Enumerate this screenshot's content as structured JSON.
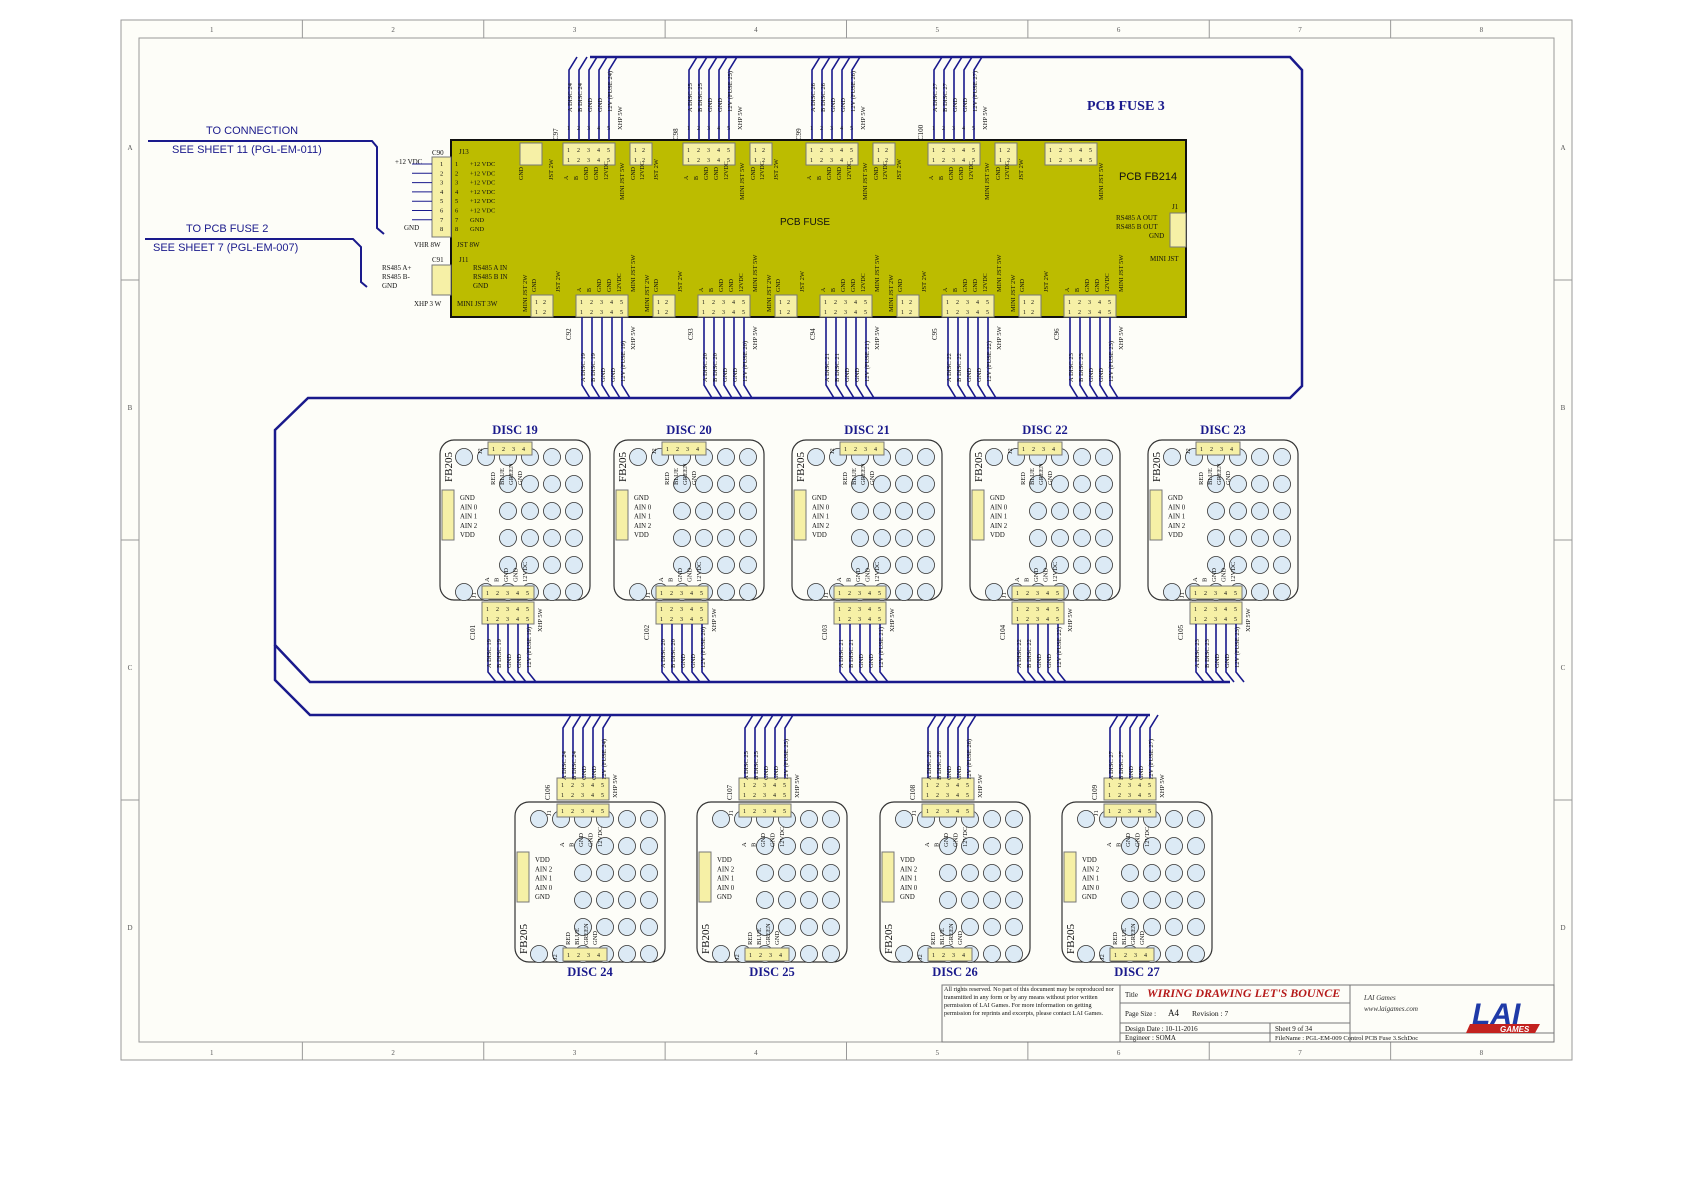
{
  "frame": {
    "columns": [
      "1",
      "2",
      "3",
      "4",
      "5",
      "6",
      "7",
      "8"
    ],
    "rows": [
      "A",
      "B",
      "C",
      "D"
    ]
  },
  "top": {
    "pcb_title": "PCB FUSE 3",
    "board_name": "PCB FB214",
    "board_center": "PCB FUSE",
    "conn1_title": "TO CONNECTION",
    "conn1_sheet": "SEE SHEET 11 (PGL-EM-011)",
    "conn2_title": "TO PCB FUSE 2",
    "conn2_sheet": "SEE SHEET 7 (PGL-EM-007)",
    "c90": "C90",
    "c91": "C91",
    "j13": "J13",
    "j11": "J11",
    "j1": "J1",
    "vdc12": "+12 VDC",
    "gnd": "GND",
    "vhr8": "VHR 8W",
    "jst8": "JST 8W",
    "rs485a": "RS485 A+",
    "rs485b": "RS485 B-",
    "rs485a_in": "RS485 A IN",
    "rs485b_in": "RS485 B IN",
    "xhp3": "XHP 3 W",
    "mini3": "MINI JST 3W",
    "rs485a_out": "RS485 A OUT",
    "rs485b_out": "RS485 B OUT",
    "mini_jst": "MINI JST",
    "pins12": [
      "+12 VDC",
      "+12 VDC",
      "+12 VDC",
      "+12 VDC",
      "+12 VDC",
      "+12 VDC",
      "GND",
      "GND"
    ],
    "top_connectors": [
      {
        "cap": "C97",
        "lines": [
          "A DISC 24",
          "B DISC 24",
          "GND",
          "GND",
          "12V (FUSE 24)"
        ]
      },
      {
        "cap": "C98",
        "lines": [
          "A DISC 25",
          "B DISC 25",
          "GND",
          "GND",
          "12V (FUSE 25)"
        ]
      },
      {
        "cap": "C99",
        "lines": [
          "A DISC 26",
          "B DISC 26",
          "GND",
          "GND",
          "12V (FUSE 26)"
        ]
      },
      {
        "cap": "C100",
        "lines": [
          "A DISC 27",
          "B DISC 27",
          "GND",
          "GND",
          "12V (FUSE 27)"
        ]
      }
    ],
    "bottom_connectors": [
      {
        "cap": "C92",
        "lines": [
          "A DISC 19",
          "B DISC 19",
          "GND",
          "GND",
          "12V (FUSE 19)"
        ]
      },
      {
        "cap": "C93",
        "lines": [
          "A DISC 20",
          "B DISC 20",
          "GND",
          "GND",
          "12V (FUSE 20)"
        ]
      },
      {
        "cap": "C94",
        "lines": [
          "A DISC 21",
          "B DISC 21",
          "GND",
          "GND",
          "12V (FUSE 21)"
        ]
      },
      {
        "cap": "C95",
        "lines": [
          "A DISC 22",
          "B DISC 22",
          "GND",
          "GND",
          "12V (FUSE 22)"
        ]
      },
      {
        "cap": "C96",
        "lines": [
          "A DISC 23",
          "B DISC 23",
          "GND",
          "GND",
          "12V (FUSE 23)"
        ]
      }
    ],
    "xhp5": "XHP 5W",
    "mini5": "MINI JST 5W",
    "jst2": "JST 2W",
    "mini2": "MINI JST 2W"
  },
  "discs_row1": [
    {
      "name": "DISC 19",
      "cap": "C101",
      "lines": [
        "A DISC 19",
        "B DISC 19",
        "GND",
        "GND",
        "12V (FUSE 19)"
      ]
    },
    {
      "name": "DISC 20",
      "cap": "C102",
      "lines": [
        "A DISC 20",
        "B DISC 20",
        "GND",
        "GND",
        "12V (FUSE 20)"
      ]
    },
    {
      "name": "DISC 21",
      "cap": "C103",
      "lines": [
        "A DISC 21",
        "B DISC 21",
        "GND",
        "GND",
        "12V (FUSE 21)"
      ]
    },
    {
      "name": "DISC 22",
      "cap": "C104",
      "lines": [
        "A DISC 22",
        "B DISC 22",
        "GND",
        "GND",
        "12V (FUSE 22)"
      ]
    },
    {
      "name": "DISC 23",
      "cap": "C105",
      "lines": [
        "A DISC 23",
        "B DISC 23",
        "GND",
        "GND",
        "12V (FUSE 23)"
      ]
    }
  ],
  "discs_row2": [
    {
      "name": "DISC 24",
      "cap": "C106",
      "lines": [
        "A DISC 24",
        "B DISC 24",
        "GND",
        "GND",
        "12V (FUSE 24)"
      ]
    },
    {
      "name": "DISC 25",
      "cap": "C107",
      "lines": [
        "A DISC 25",
        "B DISC 25",
        "GND",
        "GND",
        "12V (FUSE 25)"
      ]
    },
    {
      "name": "DISC 26",
      "cap": "C108",
      "lines": [
        "A DISC 26",
        "B DISC 26",
        "GND",
        "GND",
        "12V (FUSE 26)"
      ]
    },
    {
      "name": "DISC 27",
      "cap": "C109",
      "lines": [
        "A DISC 27",
        "B DISC 27",
        "GND",
        "GND",
        "12V (FUSE 27)"
      ]
    }
  ],
  "disc_board": {
    "label": "FB205",
    "j1": "J1",
    "j2": "J2",
    "led": [
      "RED",
      "BLUE",
      "GREEN",
      "GND"
    ],
    "ain_row1": [
      "GND",
      "AIN 0",
      "AIN 1",
      "AIN 2",
      "VDD"
    ],
    "ain_row2": [
      "VDD",
      "AIN 2",
      "AIN 1",
      "AIN 0",
      "GND"
    ],
    "j1_pins": [
      "A",
      "B",
      "GND",
      "GND",
      "12VDC"
    ],
    "xhp": "XHP 5W"
  },
  "title_block": {
    "notice": "All rights reserved. No part of this document may be reproduced nor transmitted in any form or by any means without prior written permission of LAI Games. For more information on getting permission for reprints and excerpts, please contact LAI Games.",
    "title_label": "Title",
    "title": "WIRING DRAWING LET'S BOUNCE",
    "company": "LAI Games",
    "website": "www.laigames.com",
    "page_size_label": "Page Size :",
    "page_size": "A4",
    "revision": "Revision :  7",
    "design_date": "Design Date :  10-11-2016",
    "sheet": "Sheet  9   of   34",
    "engineer": "Engineer  :  SOMA",
    "file_name": "FileName :  PGL-EM-009 Control PCB Fuse 3.SchDoc",
    "logo_text": "LAI",
    "logo_sub": "GAMES"
  },
  "colors": {
    "wire": "#1a1a8c",
    "board": "#bcbc00",
    "connector": "#f6f0a6",
    "title_red": "#b51a1a"
  }
}
